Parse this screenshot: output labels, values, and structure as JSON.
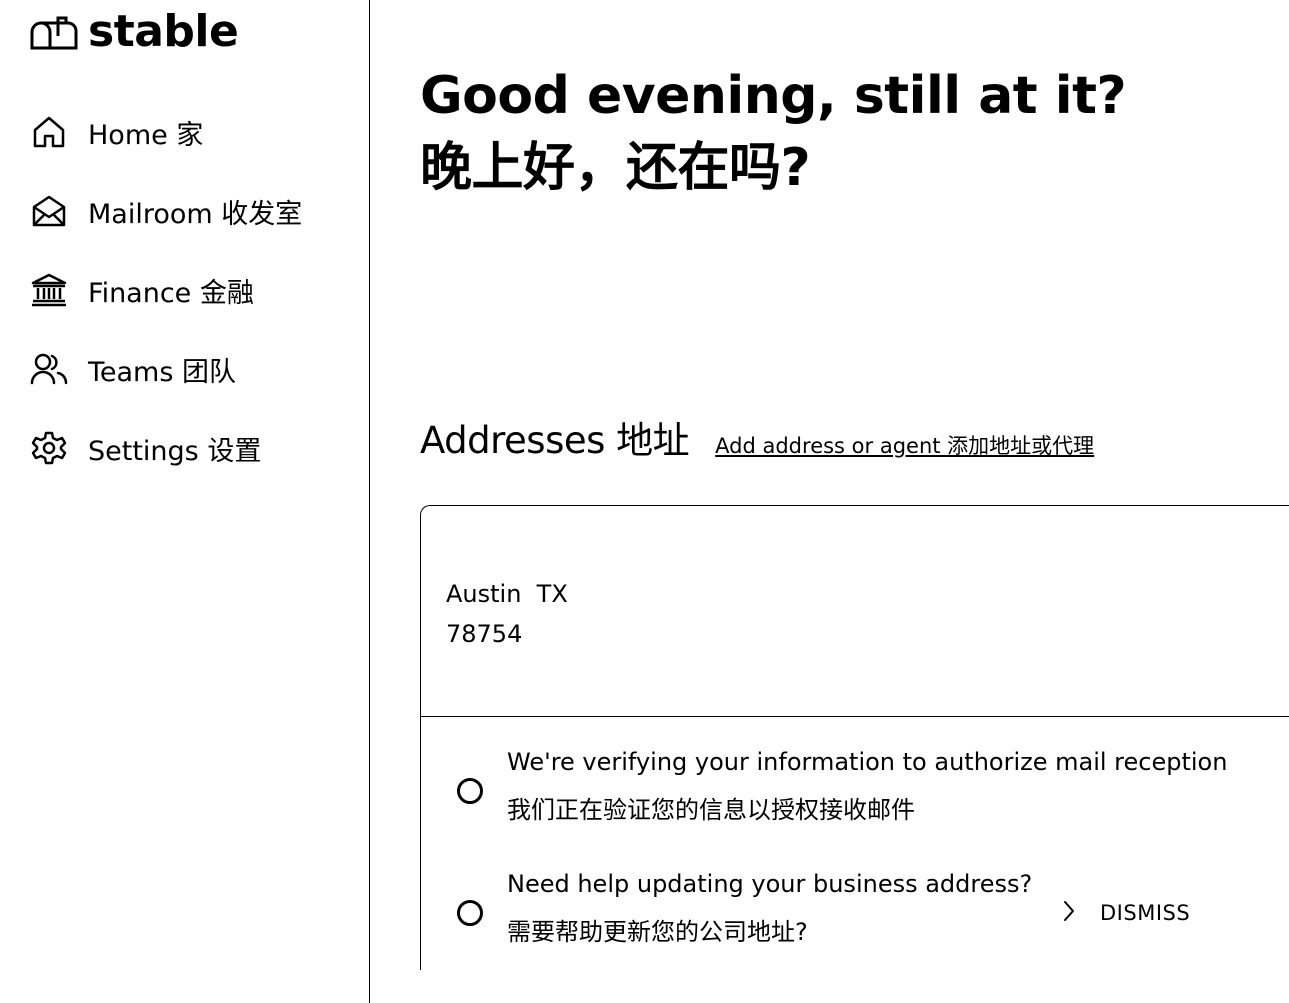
{
  "brand": {
    "name": "stable",
    "icon": "mailbox-icon"
  },
  "sidebar": {
    "items": [
      {
        "icon": "home-icon",
        "label": "Home 家"
      },
      {
        "icon": "envelope-open-icon",
        "label": "Mailroom 收发室"
      },
      {
        "icon": "bank-icon",
        "label": "Finance 金融"
      },
      {
        "icon": "people-icon",
        "label": "Teams 团队"
      },
      {
        "icon": "gear-icon",
        "label": "Settings 设置"
      }
    ]
  },
  "greeting": {
    "line1": "Good evening, still at it?",
    "line2": "晚上好，还在吗?"
  },
  "addresses": {
    "title": "Addresses 地址",
    "add_link": "Add address or agent 添加地址或代理",
    "card": {
      "city_state": "Austin  TX",
      "zip": "78754",
      "tasks": [
        {
          "status_icon": "empty-circle-icon",
          "line1": "We're verifying your information to authorize mail reception",
          "line2": "我们正在验证您的信息以授权接收邮件"
        },
        {
          "status_icon": "empty-circle-icon",
          "line1": "Need help updating your business address?",
          "line2": "需要帮助更新您的公司地址?",
          "action_icon": "chevron-right-icon",
          "action_label": "DISMISS"
        }
      ]
    }
  }
}
